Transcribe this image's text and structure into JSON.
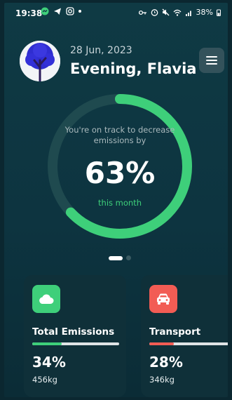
{
  "status_bar": {
    "time": "19:38",
    "battery": "38%"
  },
  "header": {
    "date": "28 Jun, 2023",
    "greeting": "Evening, Flavia",
    "avatar_icon": "tree-icon",
    "menu_icon": "hamburger-menu-icon"
  },
  "gauge": {
    "message": "You're on track to decrease emissions by",
    "percent_text": "63%",
    "progress": 0.63,
    "period": "this month",
    "track_color": "#1f4a4f",
    "progress_color": "#3ecf7a"
  },
  "pager": {
    "pages": 2,
    "active": 0
  },
  "cards": [
    {
      "title": "Total Emissions",
      "icon": "cloud-icon",
      "icon_color": "#3ecf7a",
      "percent_text": "34%",
      "progress": 0.34,
      "bar_color": "#3ecf7a",
      "amount": "456kg"
    },
    {
      "title": "Transport",
      "icon": "car-icon",
      "icon_color": "#f25c54",
      "percent_text": "28%",
      "progress": 0.28,
      "bar_color": "#f25c54",
      "amount": "346kg"
    }
  ]
}
